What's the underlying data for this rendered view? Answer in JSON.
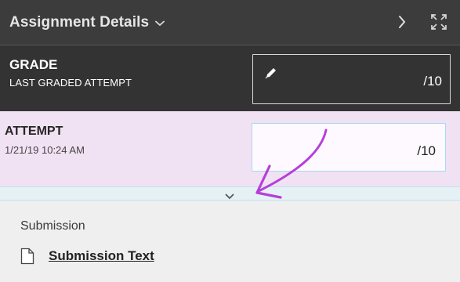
{
  "header": {
    "title": "Assignment Details",
    "title_chevron_icon": "chevron-down-icon",
    "next_icon": "chevron-right-icon",
    "expand_icon": "expand-fullscreen-icon"
  },
  "grade": {
    "label": "GRADE",
    "sublabel": "LAST GRADED ATTEMPT",
    "value": "/10",
    "edit_icon": "pencil-icon"
  },
  "attempt": {
    "label": "ATTEMPT",
    "date": "1/21/19 10:24 AM",
    "value": "/10"
  },
  "expander": {
    "icon": "chevron-down-icon"
  },
  "submission": {
    "label": "Submission",
    "link_text": "Submission Text",
    "icon": "document-icon"
  },
  "colors": {
    "header_bg": "#3c3c3c",
    "grade_bg": "#333333",
    "attempt_bg": "#f1e2f3",
    "body_bg": "#efefef",
    "annotation_arrow": "#b63fd8"
  }
}
